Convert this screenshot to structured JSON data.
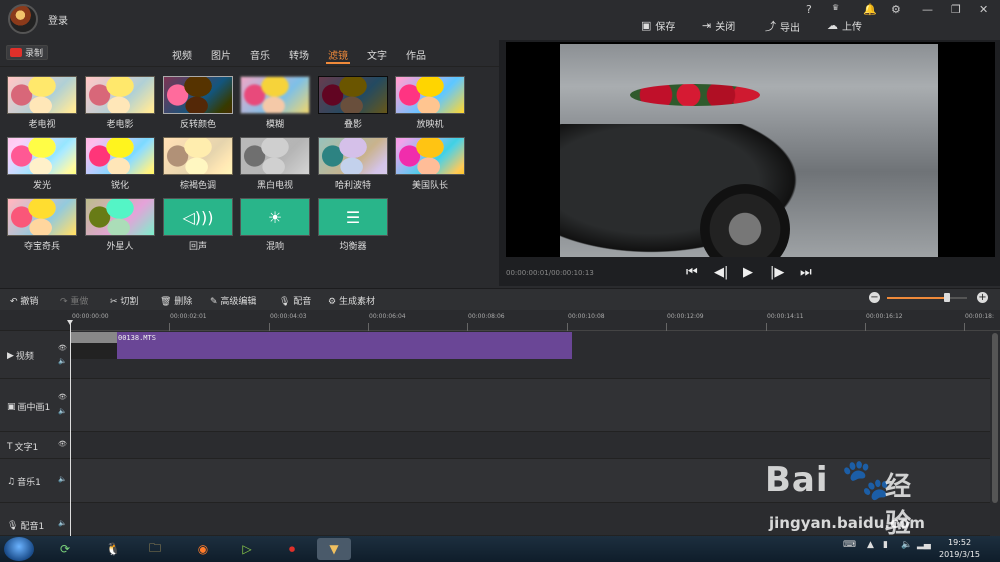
{
  "header": {
    "login_label": "登录",
    "help": "?",
    "vip": "VIP",
    "save_label": "保存",
    "close_label": "关闭",
    "export_label": "导出",
    "upload_label": "上传"
  },
  "left_panel": {
    "record_label": "录制",
    "tabs": [
      "视频",
      "图片",
      "音乐",
      "转场",
      "滤镜",
      "文字",
      "作品"
    ],
    "active_tab": "滤镜",
    "filters": [
      {
        "name": "老电视"
      },
      {
        "name": "老电影"
      },
      {
        "name": "反转颜色"
      },
      {
        "name": "模糊"
      },
      {
        "name": "叠影"
      },
      {
        "name": "放映机"
      },
      {
        "name": "发光"
      },
      {
        "name": "锐化"
      },
      {
        "name": "棕褐色调"
      },
      {
        "name": "黑白电视"
      },
      {
        "name": "哈利波特"
      },
      {
        "name": "美国队长"
      },
      {
        "name": "夺宝奇兵"
      },
      {
        "name": "外星人"
      },
      {
        "name": "回声"
      },
      {
        "name": "混响"
      },
      {
        "name": "均衡器"
      }
    ]
  },
  "preview": {
    "timecode": "00:00:00:01/00:00:10:13"
  },
  "edit_toolbar": {
    "undo": "撤销",
    "redo": "重做",
    "cut": "切割",
    "delete": "删除",
    "advanced_edit": "高级编辑",
    "dub": "配音",
    "generate": "生成素材",
    "zoom_level": 0.75
  },
  "timeline": {
    "ruler": [
      "00:00:00:00",
      "00:00:02:01",
      "00:00:04:03",
      "00:00:06:04",
      "00:00:08:06",
      "00:00:10:08",
      "00:00:12:09",
      "00:00:14:11",
      "00:00:16:12",
      "00:00:18:"
    ],
    "tracks": {
      "video": "视频",
      "pip": "画中画1",
      "text": "文字1",
      "music": "音乐1",
      "voice": "配音1"
    },
    "clip_name": "00138.MTS"
  },
  "taskbar": {
    "time": "19:52",
    "date": "2019/3/15"
  },
  "watermark": {
    "brand": "Bai",
    "brand2": "经验",
    "url": "jingyan.baidu.com"
  },
  "colors": {
    "accent": "#f08a3a",
    "clip": "#6a4696",
    "filter_green": "#29b58a"
  }
}
